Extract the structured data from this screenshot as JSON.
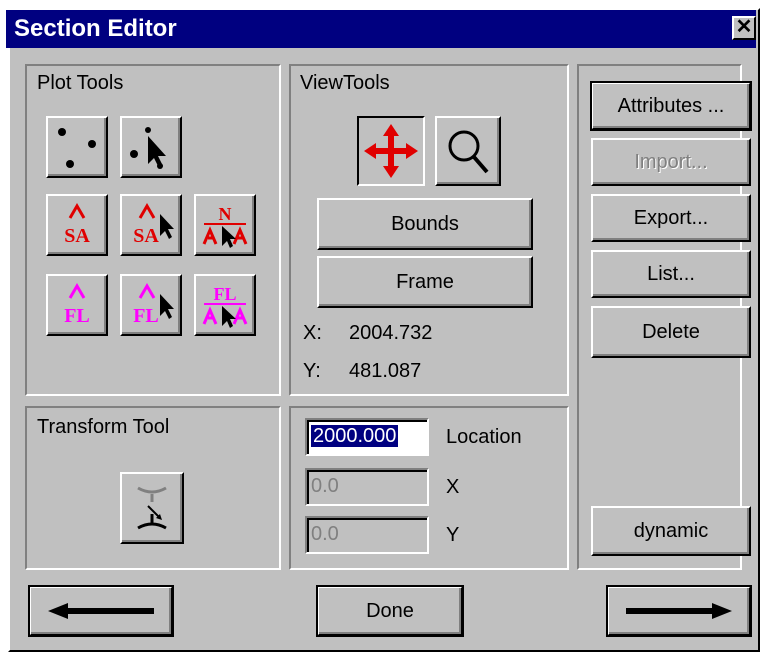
{
  "window": {
    "title": "Section Editor",
    "close_label": "✕"
  },
  "plot_tools": {
    "label": "Plot Tools",
    "tools": [
      {
        "name": "plot-points-icon"
      },
      {
        "name": "select-points-icon"
      },
      {
        "name": "sa-icon",
        "text": "SA"
      },
      {
        "name": "sa-select-icon",
        "text": "SA"
      },
      {
        "name": "n-aa-select-icon",
        "text": "N"
      },
      {
        "name": "fl-icon",
        "text": "FL"
      },
      {
        "name": "fl-select-icon",
        "text": "FL"
      },
      {
        "name": "fl-aa-select-icon",
        "text": "FL"
      }
    ]
  },
  "view_tools": {
    "label": "ViewTools",
    "bounds_label": "Bounds",
    "frame_label": "Frame",
    "x_label": "X:",
    "x_value": "2004.732",
    "y_label": "Y:",
    "y_value": "481.087"
  },
  "side_buttons": {
    "attributes": "Attributes ...",
    "import": "Import...",
    "export": "Export...",
    "list": "List...",
    "delete": "Delete",
    "dynamic": "dynamic"
  },
  "transform": {
    "label": "Transform Tool"
  },
  "location": {
    "value": "2000.000",
    "label": "Location",
    "x_value": "0.0",
    "x_label": "X",
    "y_value": "0.0",
    "y_label": "Y"
  },
  "footer": {
    "done_label": "Done"
  },
  "colors": {
    "title_bar": "#000080",
    "sa_red": "#e00000",
    "fl_magenta": "#ff00ff",
    "move_red": "#e00000"
  }
}
